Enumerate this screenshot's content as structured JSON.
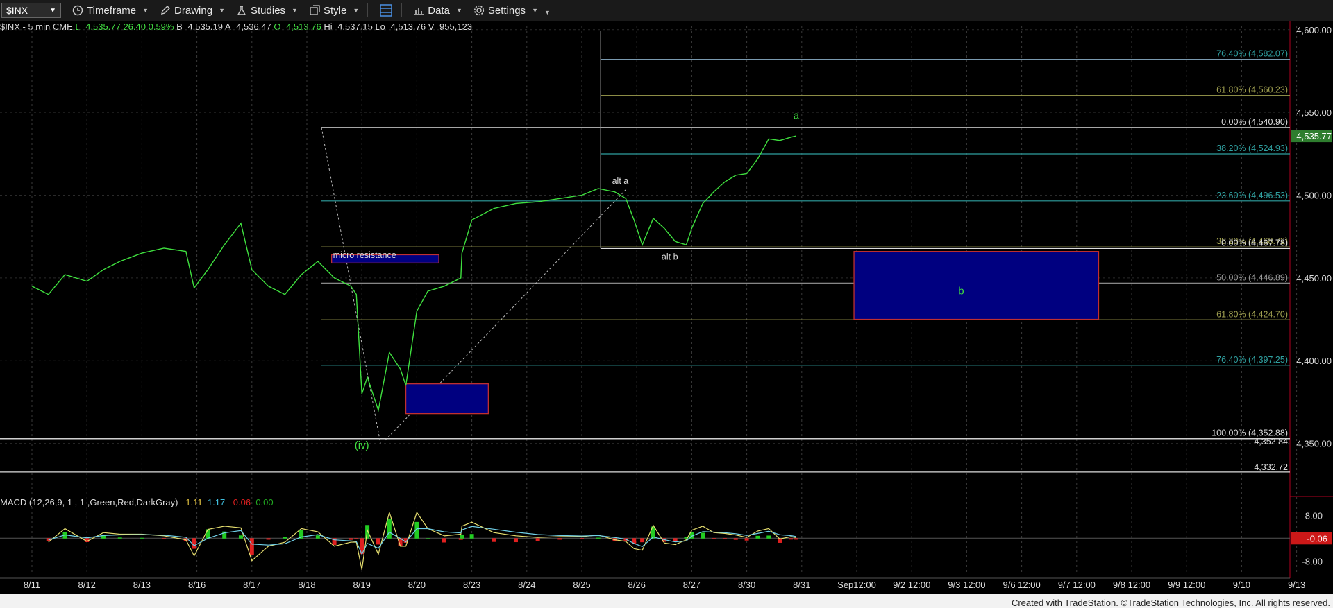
{
  "toolbar": {
    "symbol": "$INX",
    "timeframe": "Timeframe",
    "drawing": "Drawing",
    "studies": "Studies",
    "style": "Style",
    "data": "Data",
    "settings": "Settings"
  },
  "header": {
    "symbol_desc": "$INX - 5 min  CME",
    "last": "L=4,535.77",
    "change": "26.40",
    "change_pct": "0.59%",
    "bid": "B=4,535.19",
    "ask": "A=4,536.47",
    "open": "O=4,513.76",
    "high": "Hi=4,537.15",
    "low": "Lo=4,513.76",
    "volume": "V=955,123"
  },
  "macd_header": {
    "label": "MACD (12,26,9, 1 , 1 ,Green,Red,DarkGray)",
    "v1": "1.11",
    "v2": "1.17",
    "v3": "-0.06",
    "v4": "0.00"
  },
  "footer": "Created with TradeStation. ©TradeStation Technologies, Inc. All rights reserved.",
  "colors": {
    "price": "#3fe03f",
    "fib_teal": "#2fa0a0",
    "fib_olive": "#a0a050",
    "box_fill": "#000080",
    "box_border": "#c03030",
    "macd_up": "#22cc22",
    "macd_down": "#e02020",
    "last_price_bg": "#2e7d2e"
  },
  "chart_data": {
    "type": "line",
    "x_ticks": [
      "8/11",
      "8/12",
      "8/13",
      "8/16",
      "8/17",
      "8/18",
      "8/19",
      "8/20",
      "8/23",
      "8/24",
      "8/25",
      "8/26",
      "8/27",
      "8/30",
      "8/31",
      "Sep12:00",
      "9/2 12:00",
      "9/3 12:00",
      "9/6 12:00",
      "9/7 12:00",
      "9/8 12:00",
      "9/9 12:00",
      "9/10",
      "9/13"
    ],
    "y_ticks": [
      "4,600.00",
      "4,550.00",
      "4,500.00",
      "4,450.00",
      "4,400.00",
      "4,350.00"
    ],
    "ylim": [
      4318,
      4602
    ],
    "last_price": "4,535.77",
    "series": [
      {
        "values": [
          [
            0,
            4445
          ],
          [
            0.3,
            4440
          ],
          [
            0.6,
            4452
          ],
          [
            1,
            4448
          ],
          [
            1.3,
            4455
          ],
          [
            1.6,
            4460
          ],
          [
            2,
            4465
          ],
          [
            2.4,
            4468
          ],
          [
            2.8,
            4466
          ],
          [
            2.95,
            4444
          ],
          [
            3.2,
            4455
          ],
          [
            3.5,
            4470
          ],
          [
            3.8,
            4483
          ],
          [
            4.0,
            4455
          ],
          [
            4.3,
            4445
          ],
          [
            4.6,
            4440
          ],
          [
            4.9,
            4452
          ],
          [
            5.2,
            4460
          ],
          [
            5.5,
            4450
          ],
          [
            5.8,
            4445
          ],
          [
            5.9,
            4440
          ],
          [
            6.0,
            4380
          ],
          [
            6.1,
            4390
          ],
          [
            6.3,
            4370
          ],
          [
            6.5,
            4405
          ],
          [
            6.7,
            4395
          ],
          [
            6.8,
            4385
          ],
          [
            7.0,
            4430
          ],
          [
            7.2,
            4442
          ],
          [
            7.5,
            4445
          ],
          [
            7.8,
            4450
          ],
          [
            7.82,
            4465
          ],
          [
            8.0,
            4485
          ],
          [
            8.4,
            4492
          ],
          [
            8.8,
            4495
          ],
          [
            9.2,
            4496
          ],
          [
            9.6,
            4498
          ],
          [
            10.0,
            4500
          ],
          [
            10.3,
            4504
          ],
          [
            10.6,
            4502
          ],
          [
            10.8,
            4498
          ],
          [
            10.95,
            4485
          ],
          [
            11.1,
            4470
          ],
          [
            11.3,
            4486
          ],
          [
            11.5,
            4480
          ],
          [
            11.7,
            4472
          ],
          [
            11.9,
            4470
          ],
          [
            12.0,
            4480
          ],
          [
            12.2,
            4495
          ],
          [
            12.4,
            4502
          ],
          [
            12.6,
            4508
          ],
          [
            12.8,
            4512
          ],
          [
            13.0,
            4513
          ],
          [
            13.2,
            4522
          ],
          [
            13.4,
            4534
          ],
          [
            13.6,
            4533
          ],
          [
            13.8,
            4535
          ],
          [
            13.9,
            4535.77
          ]
        ]
      }
    ],
    "fib_levels": [
      {
        "label": "76.40% (4,582.07)",
        "y": 4582.07
      },
      {
        "label": "61.80% (4,560.23)",
        "y": 4560.23
      },
      {
        "label": "0.00% (4,540.90)",
        "y": 4540.9
      },
      {
        "label": "38.20% (4,524.93)",
        "y": 4524.93
      },
      {
        "label": "23.60% (4,496.53)",
        "y": 4496.53
      },
      {
        "label": "38.20% (4,468.72)",
        "y": 4468.72
      },
      {
        "label": "0.00% (4,467.78)",
        "y": 4467.78
      },
      {
        "label": "50.00% (4,446.89)",
        "y": 4446.89
      },
      {
        "label": "61.80% (4,424.70)",
        "y": 4424.7
      },
      {
        "label": "76.40% (4,397.25)",
        "y": 4397.25
      },
      {
        "label": "100.00% (4,352.88)",
        "y": 4352.88
      },
      {
        "label": "4,352.84",
        "y": 4352.84
      },
      {
        "label": "4,332.72",
        "y": 4332.72
      }
    ],
    "annotations": [
      {
        "text": "a",
        "x": 13.9,
        "y": 4546
      },
      {
        "text": "alt a",
        "x": 10.7,
        "y": 4507
      },
      {
        "text": "alt b",
        "x": 11.6,
        "y": 4461
      },
      {
        "text": "(iv)",
        "x": 6.0,
        "y": 4347
      },
      {
        "text": "micro resistance",
        "x": 6.05,
        "y": 4462
      },
      {
        "text": "b",
        "x": 16.9,
        "y": 4440
      }
    ],
    "zones": [
      {
        "name": "micro resistance",
        "x0": 5.45,
        "x1": 7.4,
        "y0": 4459,
        "y1": 4464
      },
      {
        "name": "support box",
        "x0": 6.8,
        "x1": 8.3,
        "y0": 4368,
        "y1": 4386
      },
      {
        "name": "b",
        "x0": 14.95,
        "x1": 19.4,
        "y0": 4425,
        "y1": 4466
      }
    ],
    "macd": {
      "y_ticks": [
        "8.00",
        "-8.00"
      ],
      "last": "-0.06",
      "ylim": [
        -13,
        10
      ]
    }
  }
}
